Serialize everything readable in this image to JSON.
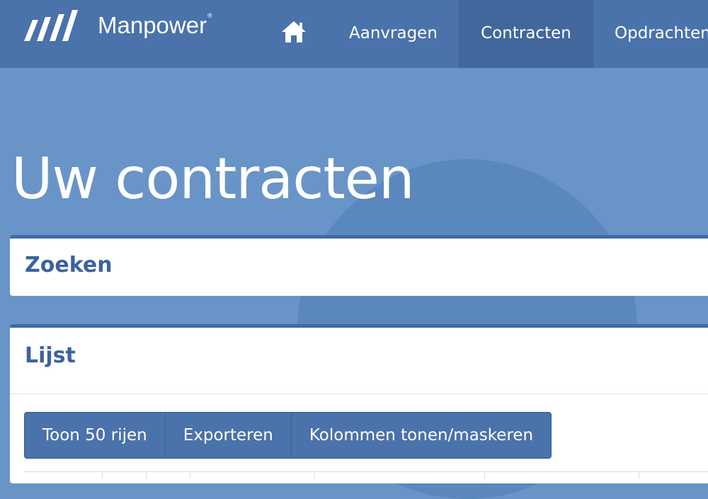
{
  "brand": {
    "name": "Manpower",
    "reg": "®"
  },
  "nav": {
    "home_icon": "home-icon",
    "items": [
      {
        "label": "Aanvragen",
        "active": false
      },
      {
        "label": "Contracten",
        "active": true
      },
      {
        "label": "Opdrachten",
        "active": false
      }
    ]
  },
  "page": {
    "title": "Uw contracten"
  },
  "search_panel": {
    "heading": "Zoeken"
  },
  "list_panel": {
    "heading": "Lijst",
    "buttons": [
      "Toon 50 rijen",
      "Exporteren",
      "Kolommen tonen/maskeren"
    ]
  },
  "colors": {
    "navbar": "#4a72ab",
    "nav_active": "#41679c",
    "background": "#6894c8",
    "heading": "#3a63a0",
    "button": "#4a72ab"
  }
}
